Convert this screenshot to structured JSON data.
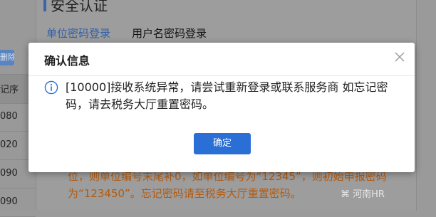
{
  "background": {
    "delete_button": "删除",
    "column_header": "记序",
    "rows": [
      "080",
      "020",
      "090",
      "090"
    ],
    "panel_title": "安全认证",
    "tabs": [
      {
        "label": "单位密码登录",
        "active": true
      },
      {
        "label": "用户名密码登录",
        "active": false
      }
    ],
    "note": "位，则单位编号末尾补0，如单位编号为“12345”，则初始申报密码为“123450”。忘记密码请至税务大厅重置密码。",
    "watermark": "河南HR"
  },
  "modal": {
    "title": "确认信息",
    "message": "[10000]接收系统异常，请尝试重新登录或联系服务商 如忘记密码，请去税务大厅重置密码。",
    "confirm_label": "确定",
    "icons": {
      "info": "info-circle-icon",
      "close": "close-icon"
    },
    "colors": {
      "accent": "#2a6fd6",
      "info_icon": "#2a6fd6"
    }
  }
}
